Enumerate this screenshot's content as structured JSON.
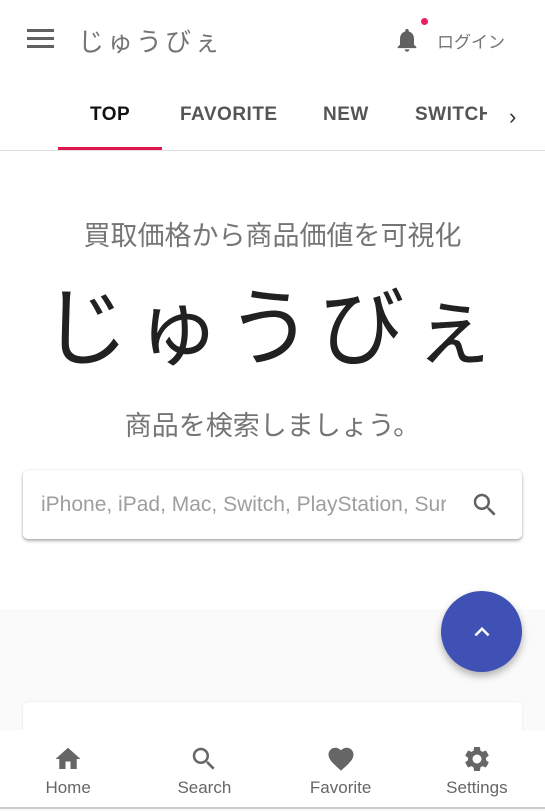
{
  "header": {
    "brand": "じゅうびぇ",
    "login": "ログイン",
    "notification_dot_color": "#e91e63"
  },
  "tabs": [
    {
      "label": "TOP",
      "active": true
    },
    {
      "label": "FAVORITE"
    },
    {
      "label": "NEW"
    },
    {
      "label": "SWITCH"
    }
  ],
  "hero": {
    "subtitle": "買取価格から商品価値を可視化",
    "title": "じゅうびぇ",
    "prompt": "商品を検索しましょう。"
  },
  "search": {
    "placeholder": "iPhone, iPad, Mac, Switch, PlayStation, Surface",
    "value": ""
  },
  "fab": {
    "icon": "chevron-up-icon",
    "color": "#3f51b5"
  },
  "bottom_nav": [
    {
      "label": "Home",
      "icon": "home-icon"
    },
    {
      "label": "Search",
      "icon": "search-icon"
    },
    {
      "label": "Favorite",
      "icon": "heart-icon"
    },
    {
      "label": "Settings",
      "icon": "gear-icon"
    }
  ]
}
